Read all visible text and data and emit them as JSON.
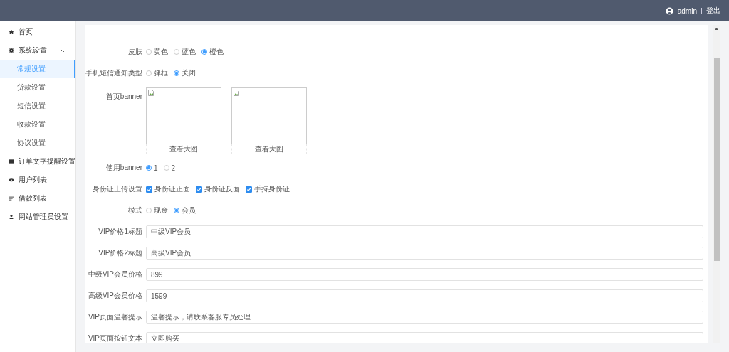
{
  "header": {
    "user": "admin",
    "logout": "登出"
  },
  "sidebar": {
    "items": [
      {
        "label": "首页",
        "selected": false
      },
      {
        "label": "系统设置",
        "selected": false,
        "expanded": true,
        "children": [
          {
            "label": "常规设置",
            "selected": true
          },
          {
            "label": "贷款设置",
            "selected": false
          },
          {
            "label": "短信设置",
            "selected": false
          },
          {
            "label": "收款设置",
            "selected": false
          },
          {
            "label": "协议设置",
            "selected": false
          }
        ]
      },
      {
        "label": "订单文字提醒设置",
        "selected": false
      },
      {
        "label": "用户列表",
        "selected": false
      },
      {
        "label": "借款列表",
        "selected": false
      },
      {
        "label": "网站管理员设置",
        "selected": false
      }
    ]
  },
  "form": {
    "rows": [
      {
        "kind": "radio",
        "label": "皮肤",
        "options": [
          {
            "label": "黄色",
            "selected": false
          },
          {
            "label": "蓝色",
            "selected": false
          },
          {
            "label": "橙色",
            "selected": true
          }
        ]
      },
      {
        "kind": "radio",
        "label": "手机短信通知类型",
        "options": [
          {
            "label": "弹框",
            "selected": false
          },
          {
            "label": "关闭",
            "selected": true
          }
        ]
      },
      {
        "kind": "images",
        "label": "首页banner",
        "images": [
          {
            "link": "查看大图"
          },
          {
            "link": "查看大图"
          }
        ]
      },
      {
        "kind": "radio",
        "label": "使用banner",
        "options": [
          {
            "label": "1",
            "selected": true
          },
          {
            "label": "2",
            "selected": false
          }
        ]
      },
      {
        "kind": "checkbox",
        "label": "身份证上传设置",
        "options": [
          {
            "label": "身份证正面",
            "checked": true
          },
          {
            "label": "身份证反面",
            "checked": true
          },
          {
            "label": "手持身份证",
            "checked": true
          }
        ]
      },
      {
        "kind": "radio",
        "label": "模式",
        "options": [
          {
            "label": "现金",
            "selected": false
          },
          {
            "label": "会员",
            "selected": true
          }
        ]
      },
      {
        "kind": "text",
        "label": "VIP价格1标题",
        "value": "中级VIP会员"
      },
      {
        "kind": "text",
        "label": "VIP价格2标题",
        "value": "高级VIP会员"
      },
      {
        "kind": "text",
        "label": "中级VIP会员价格",
        "value": "899"
      },
      {
        "kind": "text",
        "label": "高级VIP会员价格",
        "value": "1599"
      },
      {
        "kind": "text",
        "label": "VIP页面温馨提示",
        "value": "温馨提示，请联系客服专员处理"
      },
      {
        "kind": "text",
        "label": "VIP页面按钮文本",
        "value": "立即购买"
      }
    ]
  }
}
